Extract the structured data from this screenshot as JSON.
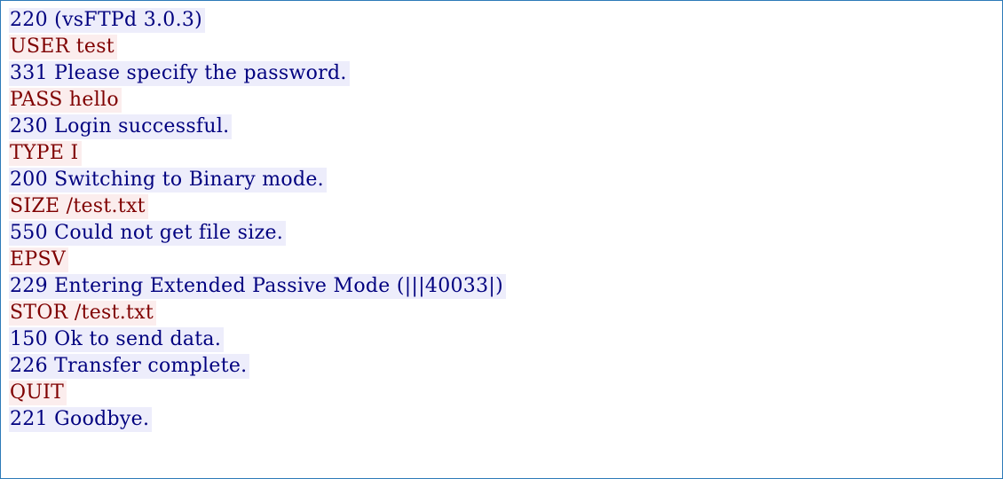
{
  "stream": {
    "lines": [
      {
        "direction": "server",
        "text": "220 (vsFTPd 3.0.3)"
      },
      {
        "direction": "client",
        "text": "USER test"
      },
      {
        "direction": "server",
        "text": "331 Please specify the password."
      },
      {
        "direction": "client",
        "text": "PASS hello"
      },
      {
        "direction": "server",
        "text": "230 Login successful."
      },
      {
        "direction": "client",
        "text": "TYPE I"
      },
      {
        "direction": "server",
        "text": "200 Switching to Binary mode."
      },
      {
        "direction": "client",
        "text": "SIZE /test.txt"
      },
      {
        "direction": "server",
        "text": "550 Could not get file size."
      },
      {
        "direction": "client",
        "text": "EPSV"
      },
      {
        "direction": "server",
        "text": "229 Entering Extended Passive Mode (|||40033|)"
      },
      {
        "direction": "client",
        "text": "STOR /test.txt"
      },
      {
        "direction": "server",
        "text": "150 Ok to send data."
      },
      {
        "direction": "server",
        "text": "226 Transfer complete."
      },
      {
        "direction": "client",
        "text": "QUIT"
      },
      {
        "direction": "server",
        "text": "221 Goodbye."
      }
    ]
  },
  "colors": {
    "client_text": "#7f0000",
    "client_background": "#fbeded",
    "server_text": "#00007f",
    "server_background": "#ededfb",
    "border": "#2d7ab8"
  }
}
